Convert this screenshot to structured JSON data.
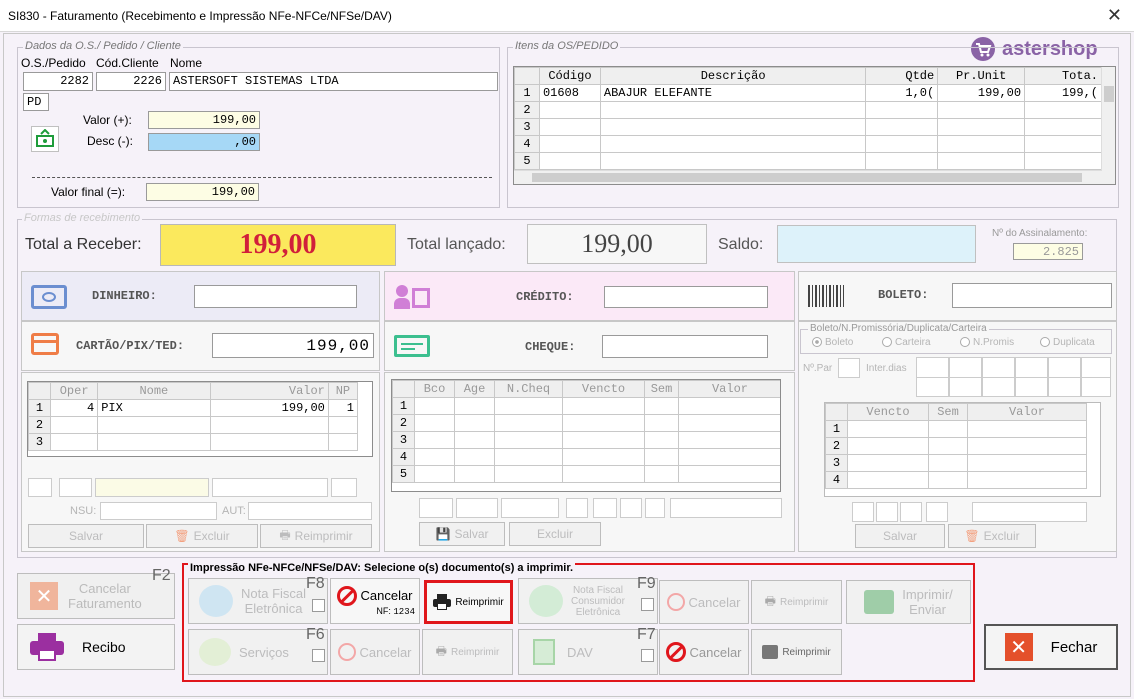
{
  "window": {
    "title": "SI830 - Faturamento (Recebimento e Impressão NFe-NFCe/NFSe/DAV)",
    "close": "✕"
  },
  "logo": {
    "text": "astershop",
    "color": "#8a63a6"
  },
  "dados": {
    "legend": "Dados da O.S./ Pedido / Cliente",
    "col_os": "O.S./Pedido",
    "col_cli": "Cód.Cliente",
    "col_nome": "Nome",
    "os": "2282",
    "cliente": "2226",
    "nome": "ASTERSOFT SISTEMAS LTDA",
    "tipo": "PD",
    "valor_label": "Valor (+):",
    "valor": "199,00",
    "desc_label": "Desc (-):",
    "desc": ",00",
    "final_label": "Valor final (=):",
    "final": "199,00"
  },
  "itens": {
    "legend": "Itens da OS/PEDIDO",
    "headers": [
      "Código",
      "Descrição",
      "Qtde",
      "Pr.Unit",
      "Tota."
    ],
    "rows": [
      {
        "n": "1",
        "codigo": "01608",
        "descricao": "ABAJUR ELEFANTE",
        "qtde": "1,0(",
        "unit": "199,00",
        "total": "199,("
      },
      {
        "n": "2",
        "codigo": "",
        "descricao": "",
        "qtde": "",
        "unit": "",
        "total": ""
      },
      {
        "n": "3",
        "codigo": "",
        "descricao": "",
        "qtde": "",
        "unit": "",
        "total": ""
      },
      {
        "n": "4",
        "codigo": "",
        "descricao": "",
        "qtde": "",
        "unit": "",
        "total": ""
      },
      {
        "n": "5",
        "codigo": "",
        "descricao": "",
        "qtde": "",
        "unit": "",
        "total": ""
      }
    ]
  },
  "formas": {
    "legend": "Formas de recebimento",
    "total_receber_label": "Total a Receber:",
    "total_receber": "199,00",
    "total_lancado_label": "Total lançado:",
    "total_lancado": "199,00",
    "saldo_label": "Saldo:",
    "saldo": "",
    "assin_label": "Nº do Assinalamento:",
    "assin": "2.825",
    "dinheiro": "DINHEIRO:",
    "cartao": "CARTÃO/PIX/TED:",
    "cartao_valor": "199,00",
    "credito": "CRÉDITO:",
    "cheque": "CHEQUE:",
    "boleto": "BOLETO:",
    "cartao_headers": [
      "Oper",
      "Nome",
      "Valor",
      "NP"
    ],
    "cartao_rows": [
      {
        "n": "1",
        "oper": "4",
        "nome": "PIX",
        "valor": "199,00",
        "np": "1"
      },
      {
        "n": "2",
        "oper": "",
        "nome": "",
        "valor": "",
        "np": ""
      },
      {
        "n": "3",
        "oper": "",
        "nome": "",
        "valor": "",
        "np": ""
      }
    ],
    "nsu": "NSU:",
    "aut": "AUT:",
    "cheque_headers": [
      "Bco",
      "Age",
      "N.Cheq",
      "Vencto",
      "Sem",
      "Valor"
    ],
    "cheque_rows": [
      "1",
      "2",
      "3",
      "4",
      "5"
    ],
    "boleto_legend": "Boleto/N.Promissória/Duplicata/Carteira",
    "boleto_opts": [
      "Boleto",
      "Carteira",
      "N.Promis",
      "Duplicata"
    ],
    "npar": "Nº.Par",
    "interdias": "Inter.dias",
    "boleto_headers": [
      "Vencto",
      "Sem",
      "Valor"
    ],
    "boleto_rows": [
      "1",
      "2",
      "3",
      "4"
    ],
    "salvar": "Salvar",
    "excluir": "Excluir",
    "reimprimir": "Reimprimir"
  },
  "bottom": {
    "cancelar_fat": "Cancelar\nFaturamento",
    "f2": "F2",
    "recibo": "Recibo",
    "impressao_legend": "Impressão NFe-NFCe/NFSe/DAV: Selecione o(s) documento(s) a imprimir.",
    "nfe": "Nota Fiscal\nEletrônica",
    "f8": "F8",
    "cancelar": "Cancelar",
    "nf_label": "NF:",
    "nf_num": "1234",
    "reimprimir": "Reimprimir",
    "nfce": "Nota Fiscal\nConsumidor\nEletrônica",
    "f9": "F9",
    "imprimir_enviar": "Imprimir/\nEnviar",
    "servicos": "Serviços",
    "f6": "F6",
    "dav": "DAV",
    "f7": "F7",
    "fechar": "Fechar",
    "highlight_color": "#e0161c"
  }
}
